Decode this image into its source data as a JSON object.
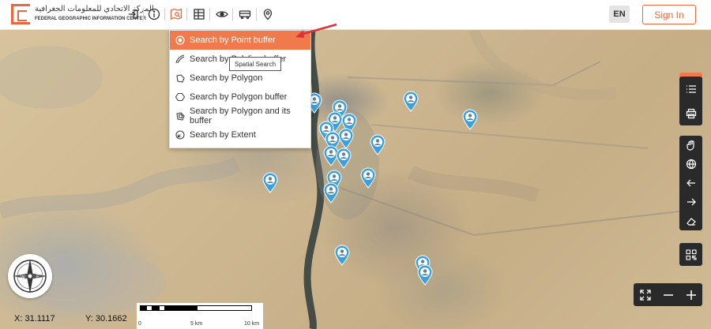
{
  "header": {
    "logo_ar": "المركز الاتحادي للمعلومات الجغرافية",
    "logo_en": "FEDERAL GEOGRAPHIC INFORMATION CENTER",
    "lang_label": "EN",
    "signin_label": "Sign In"
  },
  "toolbar": {
    "icons": [
      "login-icon",
      "info-icon",
      "spatial-search-icon",
      "table-icon",
      "eye-icon",
      "bus-icon",
      "location-pin-icon"
    ]
  },
  "spatial_search": {
    "tooltip": "Spatial Search",
    "items": [
      {
        "label": "Search by Point buffer",
        "icon": "point-buffer-icon",
        "selected": true
      },
      {
        "label": "Search by Polyline buffer",
        "icon": "polyline-buffer-icon",
        "selected": false
      },
      {
        "label": "Search by Polygon",
        "icon": "polygon-icon",
        "selected": false
      },
      {
        "label": "Search by Polygon buffer",
        "icon": "polygon-buffer-icon",
        "selected": false
      },
      {
        "label": "Search by Polygon and its buffer",
        "icon": "polygon-and-buffer-icon",
        "selected": false
      },
      {
        "label": "Search by Extent",
        "icon": "extent-icon",
        "selected": false
      }
    ]
  },
  "coordinates": {
    "x_label": "X: 31.1117",
    "y_label": "Y: 30.1662"
  },
  "scale": {
    "labels": [
      "0",
      "5 km",
      "10 km"
    ]
  },
  "colors": {
    "accent": "#e8693f",
    "menu_selected": "#f07a4c",
    "panel": "#2a2a2a",
    "pin": "#3aa0e0"
  }
}
